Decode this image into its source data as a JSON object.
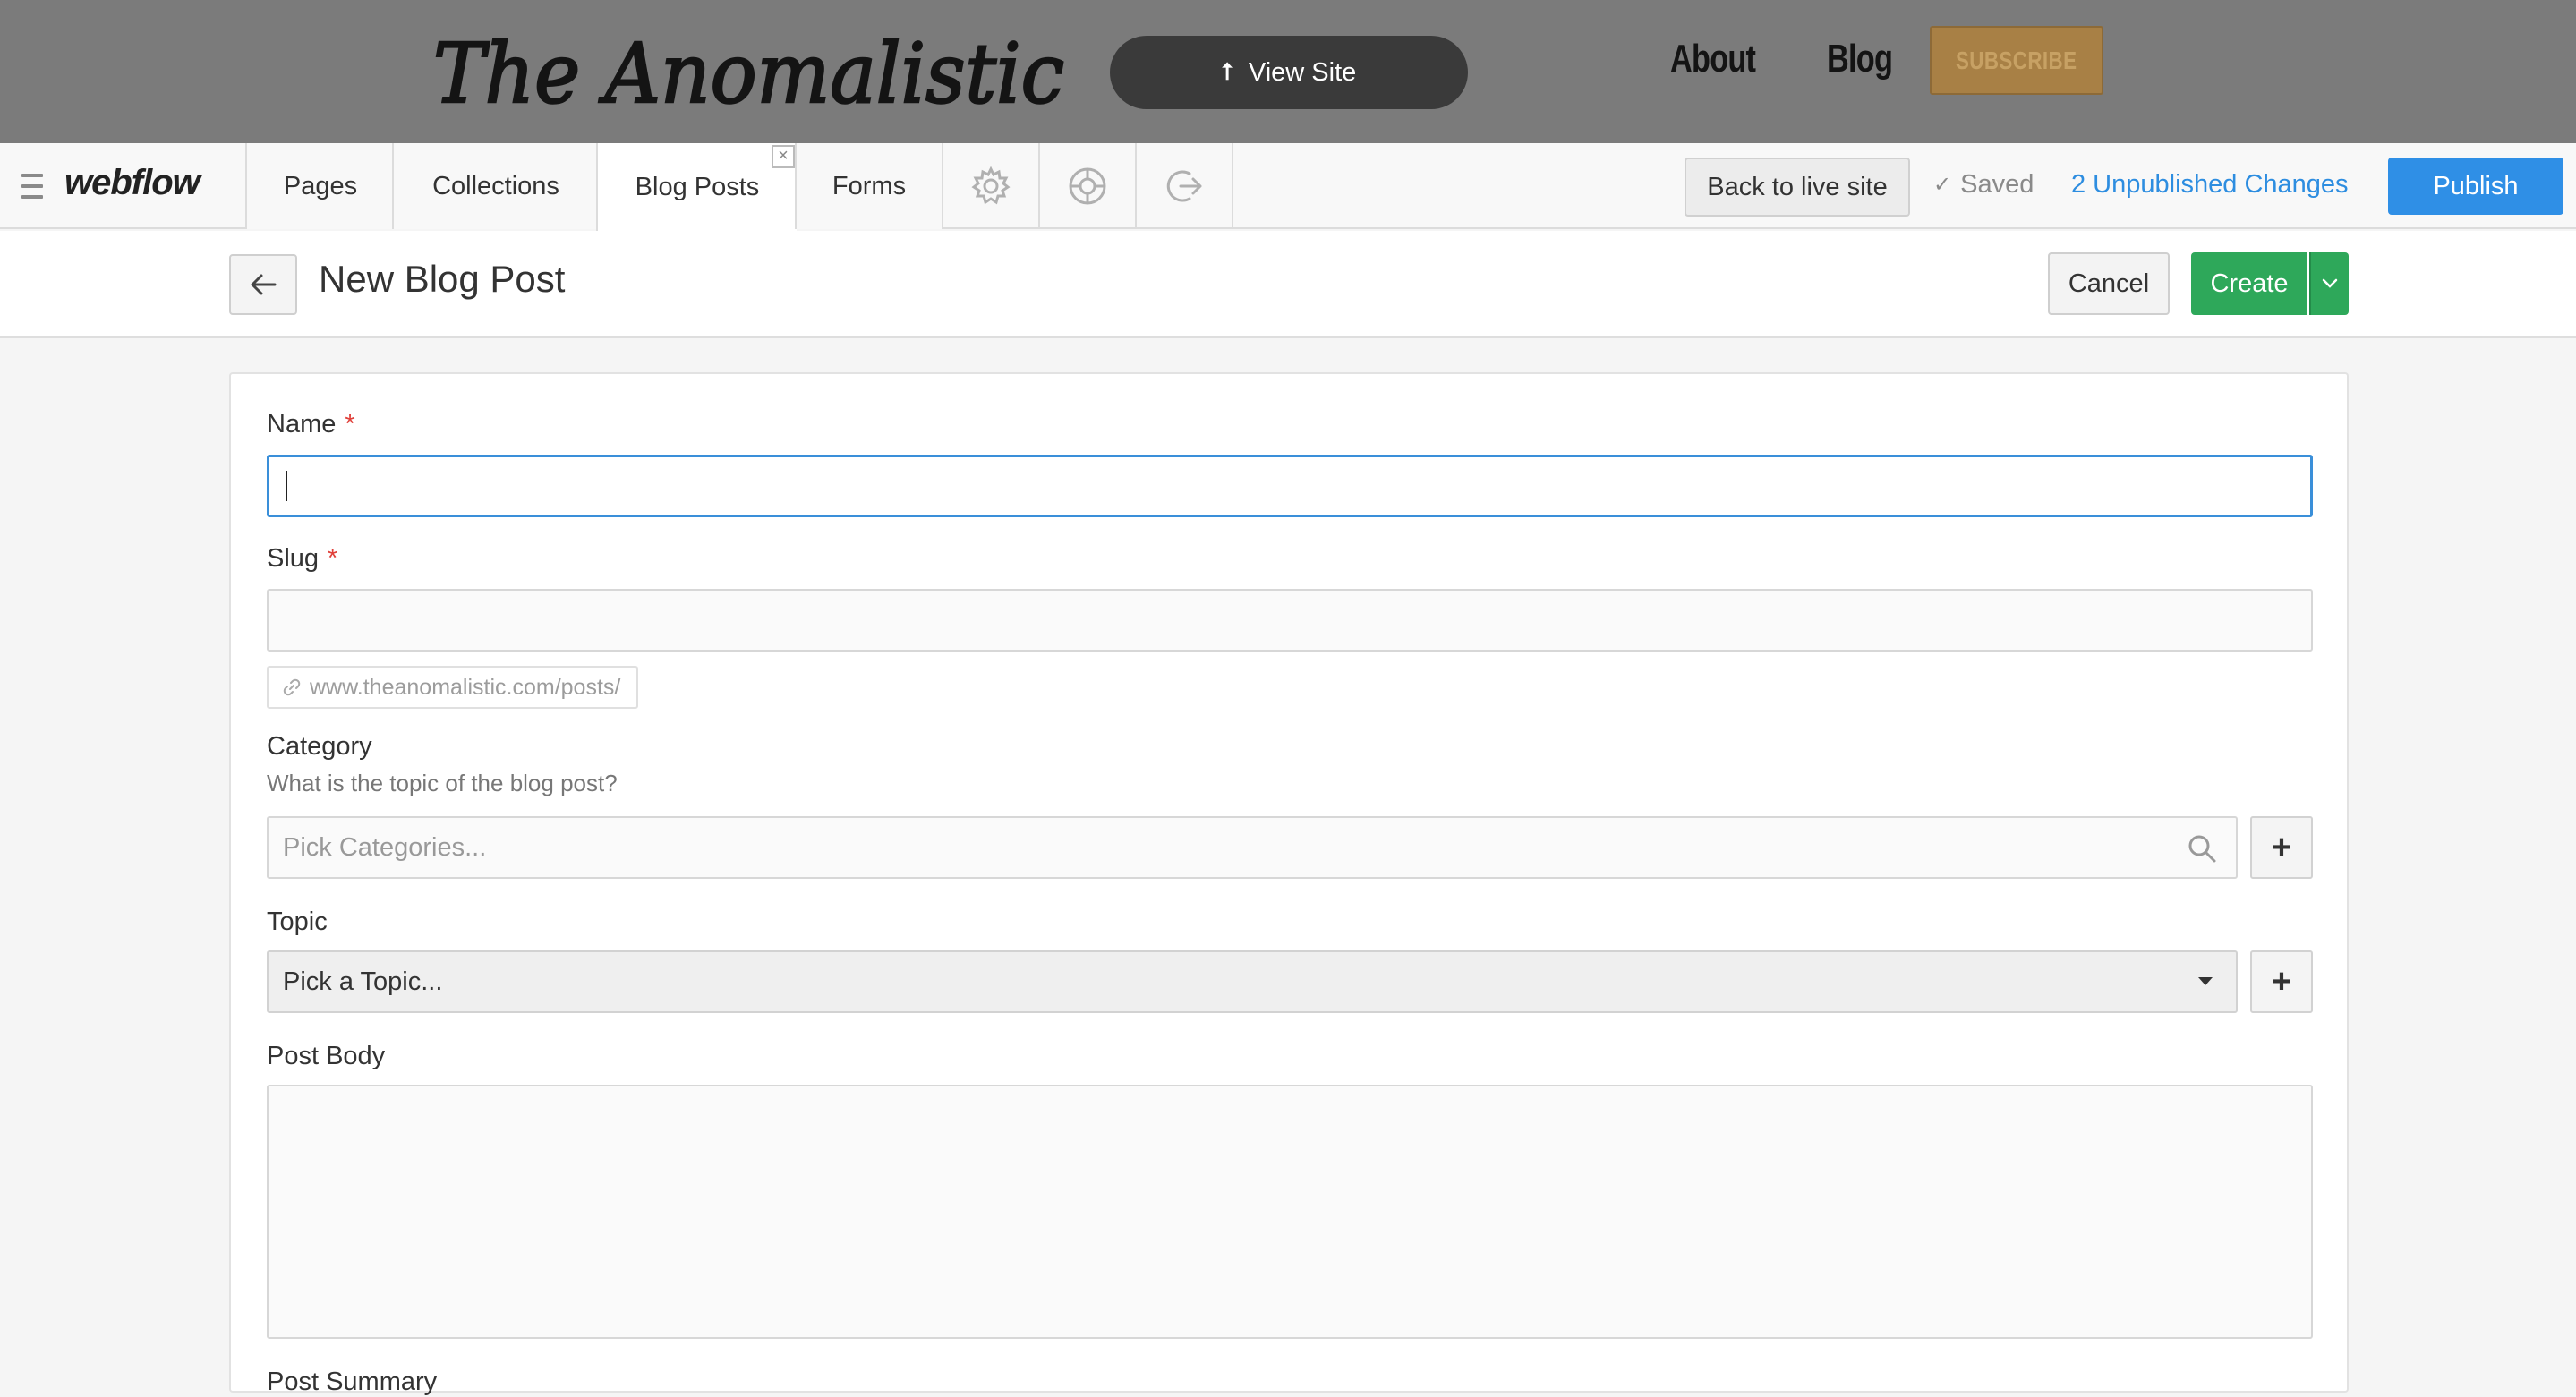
{
  "site_header": {
    "logo_text": "The Anomalistic",
    "view_site_label": "View Site",
    "nav": [
      "About",
      "Blog"
    ],
    "subscribe_label": "SUBSCRIBE",
    "background_color": "#7b7b7b",
    "subscribe_color": "#a88045"
  },
  "editor_bar": {
    "brand": "webflow",
    "tabs": [
      "Pages",
      "Collections",
      "Blog Posts",
      "Forms"
    ],
    "active_tab": "Blog Posts",
    "icon_tabs": [
      "gear-icon",
      "lifebuoy-icon",
      "logout-icon"
    ],
    "back_to_live_label": "Back to live site",
    "saved_label": "Saved",
    "unpublished_label": "2 Unpublished Changes",
    "publish_label": "Publish",
    "publish_color": "#2f8fe6"
  },
  "title_bar": {
    "title": "New Blog Post",
    "cancel_label": "Cancel",
    "create_label": "Create",
    "create_color": "#2ea85a"
  },
  "form": {
    "name": {
      "label": "Name",
      "required": "*",
      "value": ""
    },
    "slug": {
      "label": "Slug",
      "required": "*",
      "value": "",
      "url_prefix": "www.theanomalistic.com/posts/"
    },
    "category": {
      "label": "Category",
      "help": "What is the topic of the blog post?",
      "placeholder": "Pick Categories..."
    },
    "topic": {
      "label": "Topic",
      "selected": "Pick a Topic..."
    },
    "post_body": {
      "label": "Post Body",
      "value": ""
    },
    "post_summary": {
      "label": "Post Summary"
    },
    "add_symbol": "+"
  }
}
